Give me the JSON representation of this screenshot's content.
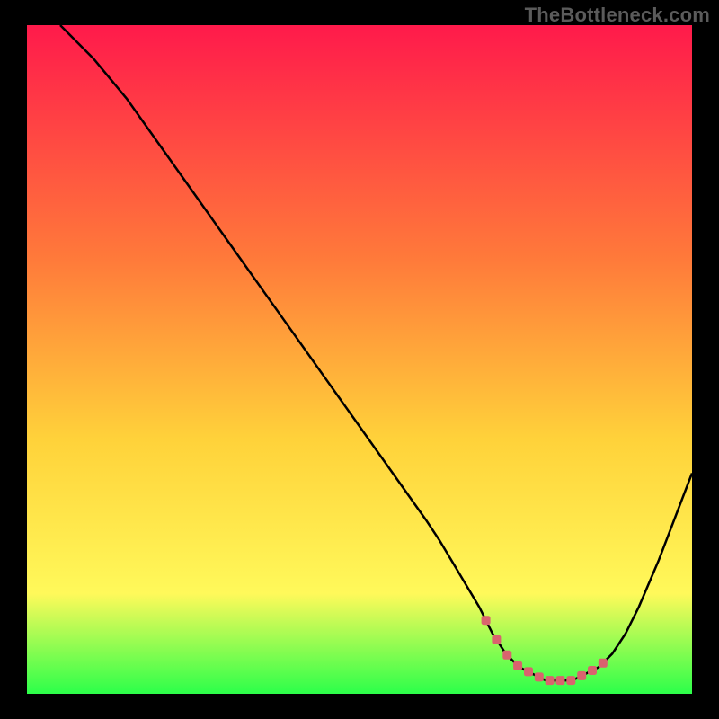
{
  "watermark": "TheBottleneck.com",
  "colors": {
    "gradient_top": "#ff1a4b",
    "gradient_mid1": "#ff7a3a",
    "gradient_mid2": "#ffd23a",
    "gradient_mid3": "#fff95a",
    "gradient_bottom": "#2cff4a",
    "curve": "#000000",
    "optimal_marker": "#d9636e",
    "frame_bg": "#000000"
  },
  "chart_data": {
    "type": "line",
    "title": "",
    "xlabel": "",
    "ylabel": "",
    "xlim": [
      0,
      100
    ],
    "ylim": [
      0,
      100
    ],
    "legend": false,
    "series": [
      {
        "name": "bottleneck-curve",
        "x": [
          5,
          10,
          15,
          20,
          25,
          30,
          35,
          40,
          45,
          50,
          55,
          60,
          62,
          65,
          68,
          70,
          72,
          74,
          76,
          78,
          80,
          82,
          84,
          86,
          88,
          90,
          92,
          95,
          100
        ],
        "y": [
          100,
          95,
          89,
          82,
          75,
          68,
          61,
          54,
          47,
          40,
          33,
          26,
          23,
          18,
          13,
          9,
          6,
          4,
          3,
          2,
          2,
          2,
          3,
          4,
          6,
          9,
          13,
          20,
          33
        ]
      }
    ],
    "optimal_range": {
      "x_start": 69,
      "x_end": 88,
      "marker_y": 4
    },
    "annotations": []
  }
}
